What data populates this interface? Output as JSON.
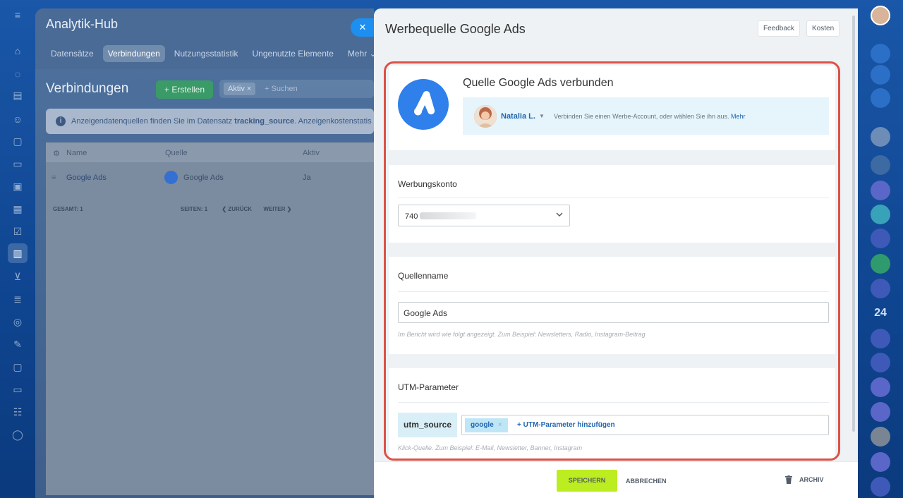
{
  "background": {
    "app_title": "Analytik-Hub",
    "tabs": [
      {
        "label": "Datensätze"
      },
      {
        "label": "Verbindungen"
      },
      {
        "label": "Nutzungsstatistik"
      },
      {
        "label": "Ungenutzte Elemente"
      },
      {
        "label": "Mehr ⌄"
      }
    ],
    "page_heading": "Verbindungen",
    "create_label": "+ Erstellen",
    "filter_chip": "Aktiv ×",
    "search_placeholder": "+ Suchen",
    "info_text_prefix": "Anzeigendatenquellen finden Sie im Datensatz ",
    "info_text_bold": "tracking_source",
    "info_text_suffix": ". Anzeigenkostenstatis",
    "table": {
      "columns": [
        "Name",
        "Quelle",
        "Aktiv"
      ],
      "rows": [
        {
          "name": "Google Ads",
          "source": "Google Ads",
          "active": "Ja"
        }
      ],
      "total_label": "GESAMT: 1",
      "pages_label": "SEITEN: 1",
      "prev_label": "❮ ZURÜCK",
      "next_label": "WEITER ❯"
    }
  },
  "panel": {
    "title": "Werbequelle Google Ads",
    "feedback_label": "Feedback",
    "costs_label": "Kosten",
    "connected": {
      "title": "Quelle Google Ads verbunden",
      "user_name": "Natalia L.",
      "hint": "Verbinden Sie einen Werbe-Account, oder wählen Sie ihn aus.",
      "more_link": "Mehr"
    },
    "account": {
      "label": "Werbungskonto",
      "value": "740"
    },
    "source_name": {
      "label": "Quellenname",
      "value": "Google Ads",
      "hint": "Im Bericht wird wie folgt angezeigt. Zum Beispiel: Newsletters, Radio, Instagram-Beitrag"
    },
    "utm": {
      "label": "UTM-Parameter",
      "key": "utm_source",
      "tag": "google",
      "add_label": "+ UTM-Parameter hinzufügen",
      "hint": "Klick-Quelle. Zum Beispiel: E-Mail, Newsletter, Banner, Instagram"
    },
    "footer": {
      "save_label": "SPEICHERN",
      "cancel_label": "ABBRECHEN",
      "archive_label": "ARCHIV"
    }
  },
  "right_rail": {
    "badge_label": "24"
  },
  "colors": {
    "accent": "#2f80ea",
    "save": "#bbed21",
    "highlight_frame": "#dc5248"
  }
}
